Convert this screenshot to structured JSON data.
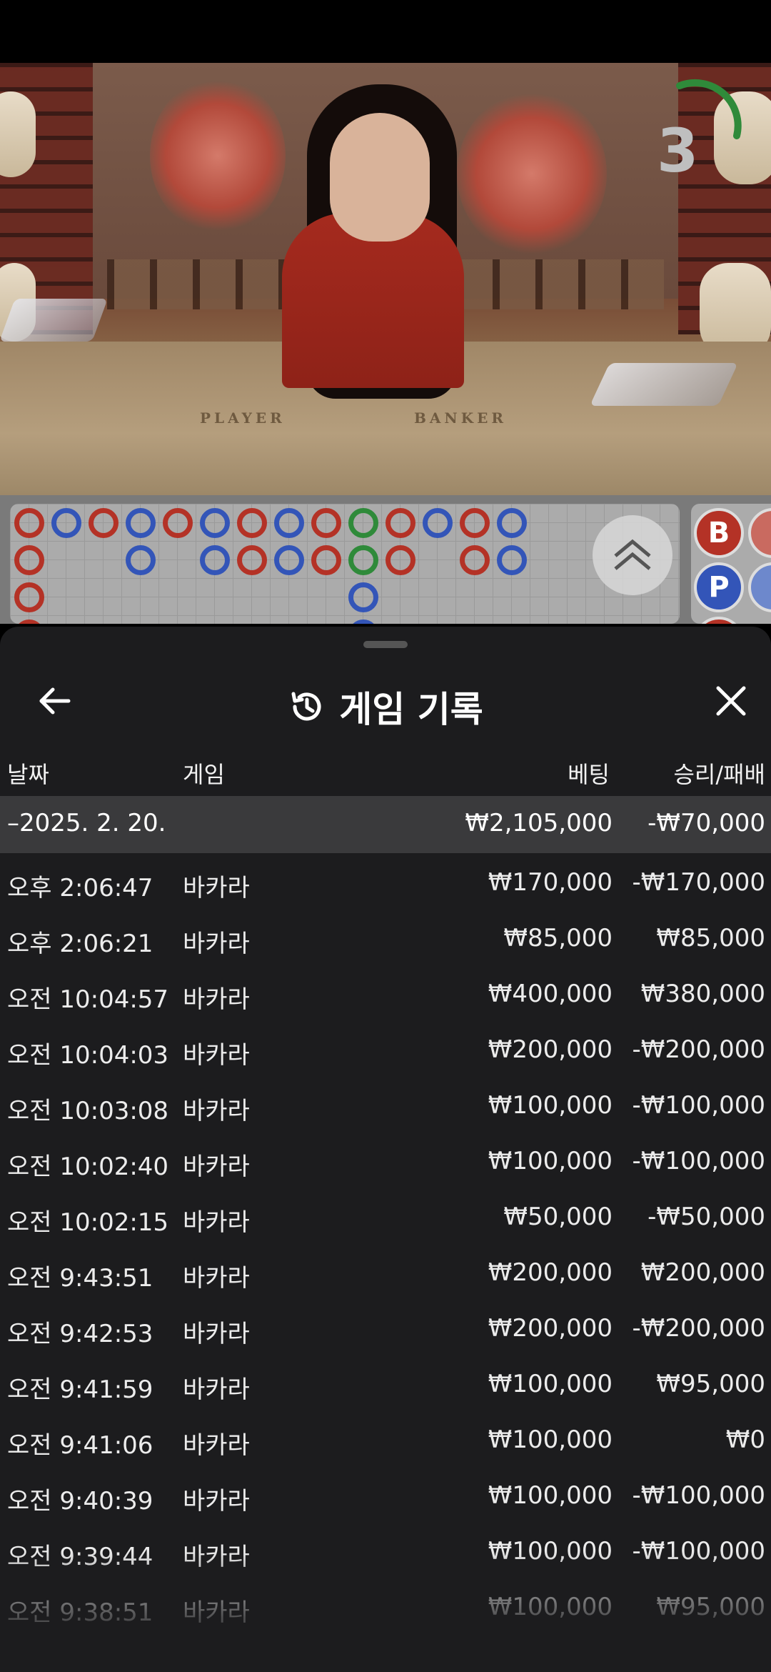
{
  "stream": {
    "countdown": "3",
    "table_labels": {
      "player": "PLAYER",
      "banker": "BANKER"
    }
  },
  "roadmap": {
    "side_buttons": [
      "B",
      "P"
    ]
  },
  "sheet": {
    "title": "게임 기록",
    "columns": {
      "date": "날짜",
      "game": "게임",
      "bet": "베팅",
      "win_loss": "승리/패배"
    },
    "date_group": {
      "label": "–2025. 2. 20.",
      "bet_total": "₩2,105,000",
      "win_loss_total": "-₩70,000"
    },
    "rows": [
      {
        "time": "오후 2:06:47",
        "game": "바카라",
        "bet": "₩170,000",
        "win_loss": "-₩170,000"
      },
      {
        "time": "오후 2:06:21",
        "game": "바카라",
        "bet": "₩85,000",
        "win_loss": "₩85,000"
      },
      {
        "time": "오전 10:04:57",
        "game": "바카라",
        "bet": "₩400,000",
        "win_loss": "₩380,000"
      },
      {
        "time": "오전 10:04:03",
        "game": "바카라",
        "bet": "₩200,000",
        "win_loss": "-₩200,000"
      },
      {
        "time": "오전 10:03:08",
        "game": "바카라",
        "bet": "₩100,000",
        "win_loss": "-₩100,000"
      },
      {
        "time": "오전 10:02:40",
        "game": "바카라",
        "bet": "₩100,000",
        "win_loss": "-₩100,000"
      },
      {
        "time": "오전 10:02:15",
        "game": "바카라",
        "bet": "₩50,000",
        "win_loss": "-₩50,000"
      },
      {
        "time": "오전 9:43:51",
        "game": "바카라",
        "bet": "₩200,000",
        "win_loss": "₩200,000"
      },
      {
        "time": "오전 9:42:53",
        "game": "바카라",
        "bet": "₩200,000",
        "win_loss": "-₩200,000"
      },
      {
        "time": "오전 9:41:59",
        "game": "바카라",
        "bet": "₩100,000",
        "win_loss": "₩95,000"
      },
      {
        "time": "오전 9:41:06",
        "game": "바카라",
        "bet": "₩100,000",
        "win_loss": "₩0"
      },
      {
        "time": "오전 9:40:39",
        "game": "바카라",
        "bet": "₩100,000",
        "win_loss": "-₩100,000"
      },
      {
        "time": "오전 9:39:44",
        "game": "바카라",
        "bet": "₩100,000",
        "win_loss": "-₩100,000"
      },
      {
        "time": "오전 9:38:51",
        "game": "바카라",
        "bet": "₩100,000",
        "win_loss": "₩95,000"
      }
    ]
  },
  "colors": {
    "banker_red": "#b43226",
    "player_blue": "#3355b8",
    "sheet_bg": "#1c1c1e",
    "date_row_bg": "#3a3a3c"
  }
}
